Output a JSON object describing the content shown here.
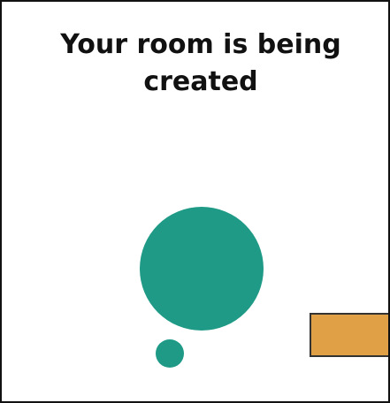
{
  "dialog": {
    "title_line1": "Your room is being",
    "title_line2": "created"
  },
  "colors": {
    "loader": "#1e9a87",
    "accent_block": "#e0a046",
    "text": "#111111",
    "background": "#ffffff"
  },
  "icons": {
    "loader": "loading-dots-icon"
  }
}
